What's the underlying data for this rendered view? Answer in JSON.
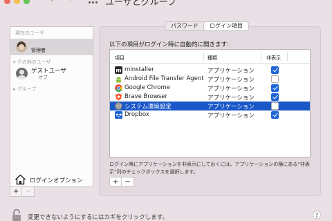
{
  "window": {
    "title": "ユーザとグループ",
    "back_glyph": "‹",
    "forward_glyph": "›"
  },
  "sidebar": {
    "current_section": "現在のユーザ",
    "current_user_role": "管理者",
    "other_section": "その他のユーザ",
    "guest_name": "ゲストユーザ",
    "guest_status": "オフ",
    "group_section": "グループ",
    "login_options": "ログインオプション",
    "add_label": "+",
    "remove_label": "−"
  },
  "tabs": [
    {
      "label": "パスワード",
      "selected": false
    },
    {
      "label": "ログイン項目",
      "selected": true
    }
  ],
  "login_items": {
    "instruction": "以下の項目がログイン時に自動的に開きます:",
    "columns": {
      "item": "項目",
      "kind": "種類",
      "hide": "非表示"
    },
    "rows": [
      {
        "name": "mInstaller",
        "kind": "アプリケーション",
        "hidden": true,
        "icon": "minstaller-icon",
        "selected": false
      },
      {
        "name": "Android File Transfer Agent",
        "kind": "アプリケーション",
        "hidden": false,
        "icon": "android-icon",
        "selected": false
      },
      {
        "name": "Google Chrome",
        "kind": "アプリケーション",
        "hidden": true,
        "icon": "chrome-icon",
        "selected": false
      },
      {
        "name": "Brave Browser",
        "kind": "アプリケーション",
        "hidden": true,
        "icon": "brave-icon",
        "selected": false
      },
      {
        "name": "システム環境設定",
        "kind": "アプリケーション",
        "hidden": false,
        "icon": "system-preferences-icon",
        "selected": true
      },
      {
        "name": "Dropbox",
        "kind": "アプリケーション",
        "hidden": true,
        "icon": "dropbox-icon",
        "selected": false
      }
    ],
    "note": "ログイン時にアプリケーションを非表示にしておくには、アプリケーションの横にある“非表示”列のチェックボックスを選択します。",
    "add_label": "+",
    "remove_label": "−"
  },
  "footer": {
    "lock_text": "変更できないようにするにはカギをクリックします。",
    "help_label": "?"
  },
  "colors": {
    "accent": "#1e66d6",
    "selection": "#1b58c7",
    "background": "#e9e1e6"
  }
}
